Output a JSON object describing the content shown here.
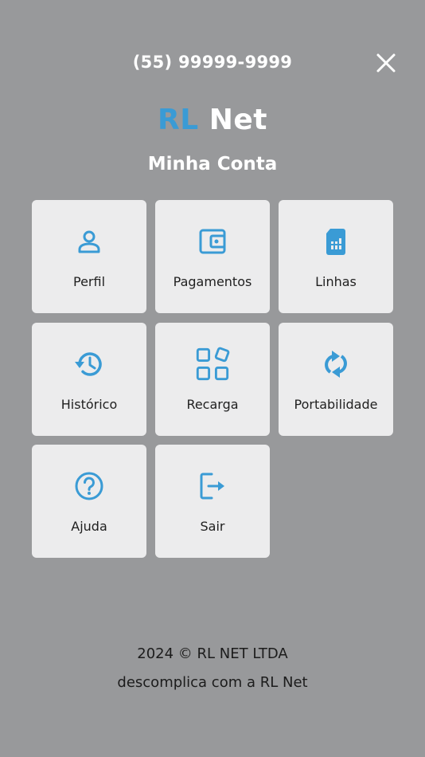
{
  "header": {
    "phone_number": "(55) 99999-9999",
    "close_icon": "close-icon"
  },
  "brand": {
    "part1": "RL",
    "part2": "Net",
    "accent_color": "#3a9bd5"
  },
  "page_title": "Minha Conta",
  "menu": [
    {
      "label": "Perfil",
      "icon": "user-icon"
    },
    {
      "label": "Pagamentos",
      "icon": "wallet-icon"
    },
    {
      "label": "Linhas",
      "icon": "sim-card-icon"
    },
    {
      "label": "Histórico",
      "icon": "history-icon"
    },
    {
      "label": "Recarga",
      "icon": "apps-icon"
    },
    {
      "label": "Portabilidade",
      "icon": "refresh-icon"
    },
    {
      "label": "Ajuda",
      "icon": "help-icon"
    },
    {
      "label": "Sair",
      "icon": "logout-icon"
    }
  ],
  "footer": {
    "copyright": "2024 ©  RL NET LTDA",
    "tagline": "descomplica com a  RL Net"
  }
}
